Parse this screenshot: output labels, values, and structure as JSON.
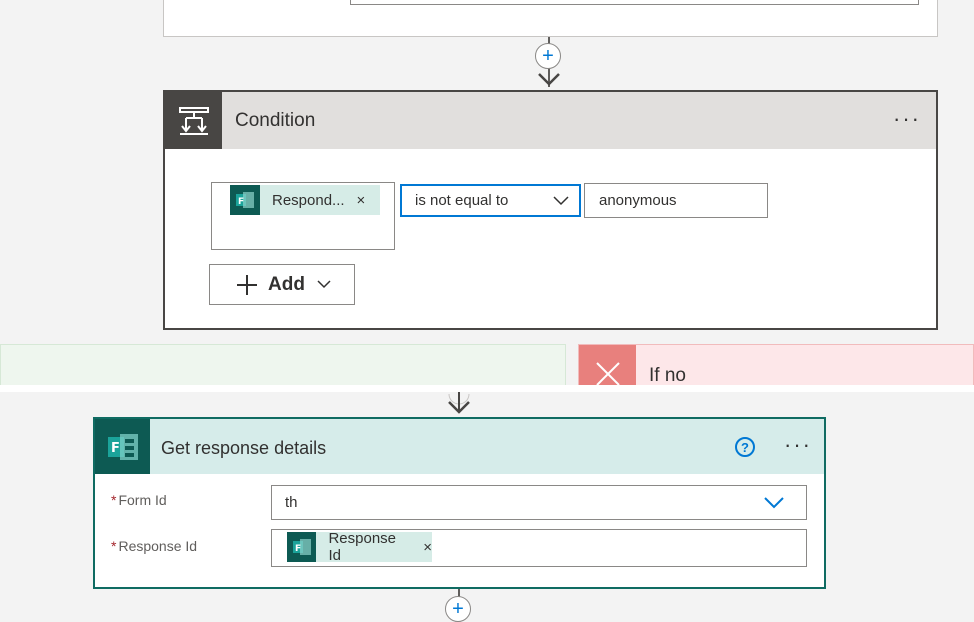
{
  "condition": {
    "title": "Condition",
    "more_label": "···",
    "left_token": {
      "label": "Respond...",
      "remove": "×"
    },
    "operator": "is not equal to",
    "value": "anonymous",
    "add_label": "Add"
  },
  "branches": {
    "no_label": "If no"
  },
  "get_response_details": {
    "title": "Get response details",
    "help_label": "?",
    "more_label": "···",
    "fields": {
      "form_id": {
        "label": "Form Id",
        "required_mark": "*",
        "value": "th"
      },
      "response_id": {
        "label": "Response Id",
        "required_mark": "*",
        "token_label": "Response Id",
        "token_remove": "×"
      }
    }
  },
  "connector": {
    "plus_label": "+"
  },
  "colors": {
    "accent": "#0078d4",
    "condition_header": "#484644",
    "forms_brand": "#0d5a53",
    "no_branch": "#fde7e9",
    "yes_branch": "#eef6ee"
  }
}
